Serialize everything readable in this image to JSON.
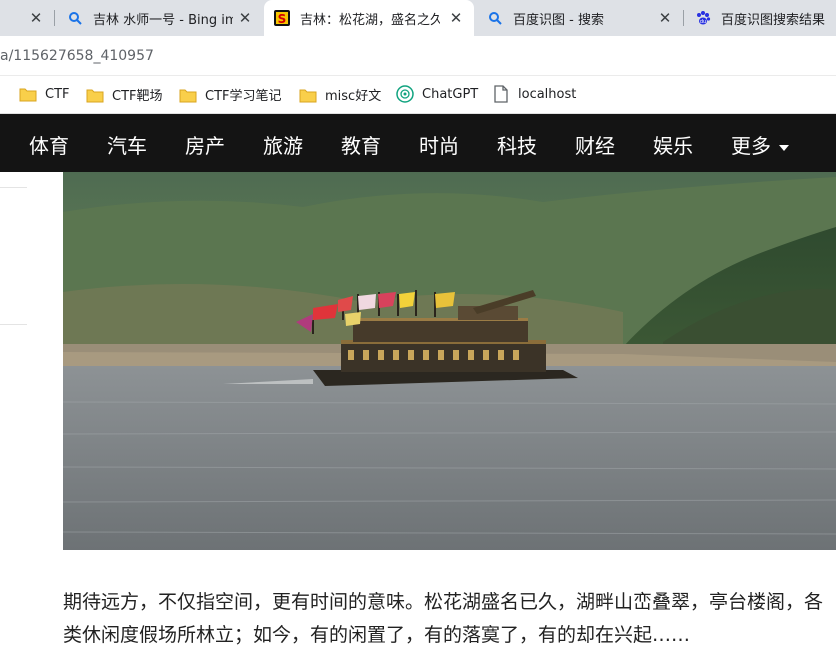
{
  "browser": {
    "tabs": [
      {
        "title": "",
        "icon": "close-icon"
      },
      {
        "title": "吉林 水师一号 - Bing im",
        "icon": "search-icon"
      },
      {
        "title": "吉林：松花湖，盛名之久",
        "icon": "sohu-logo-icon",
        "active": true
      },
      {
        "title": "百度识图 - 搜索",
        "icon": "search-icon"
      },
      {
        "title": "百度识图搜索结果",
        "icon": "baidu-paw-icon"
      }
    ],
    "url": "a/115627658_410957",
    "bookmarks": [
      {
        "label": "CTF",
        "icon": "folder-icon"
      },
      {
        "label": "CTF靶场",
        "icon": "folder-icon"
      },
      {
        "label": "CTF学习笔记",
        "icon": "folder-icon"
      },
      {
        "label": "misc好文",
        "icon": "folder-icon"
      },
      {
        "label": "ChatGPT",
        "icon": "chatgpt-icon"
      },
      {
        "label": "localhost",
        "icon": "page-icon"
      }
    ]
  },
  "site": {
    "nav": [
      "体育",
      "汽车",
      "房产",
      "旅游",
      "教育",
      "时尚",
      "科技",
      "财经",
      "娱乐",
      "更多"
    ],
    "colors": {
      "nav_bg": "#141414",
      "nav_text": "#ffffff"
    }
  },
  "article": {
    "paragraph_line1": "期待远方，不仅指空间，更有时间的意味。松花湖盛名已久，湖畔山峦叠翠，亭台楼阁，各",
    "paragraph_line2": "类休闲度假场所林立；如今，有的闲置了，有的落寞了，有的却在兴起……"
  }
}
